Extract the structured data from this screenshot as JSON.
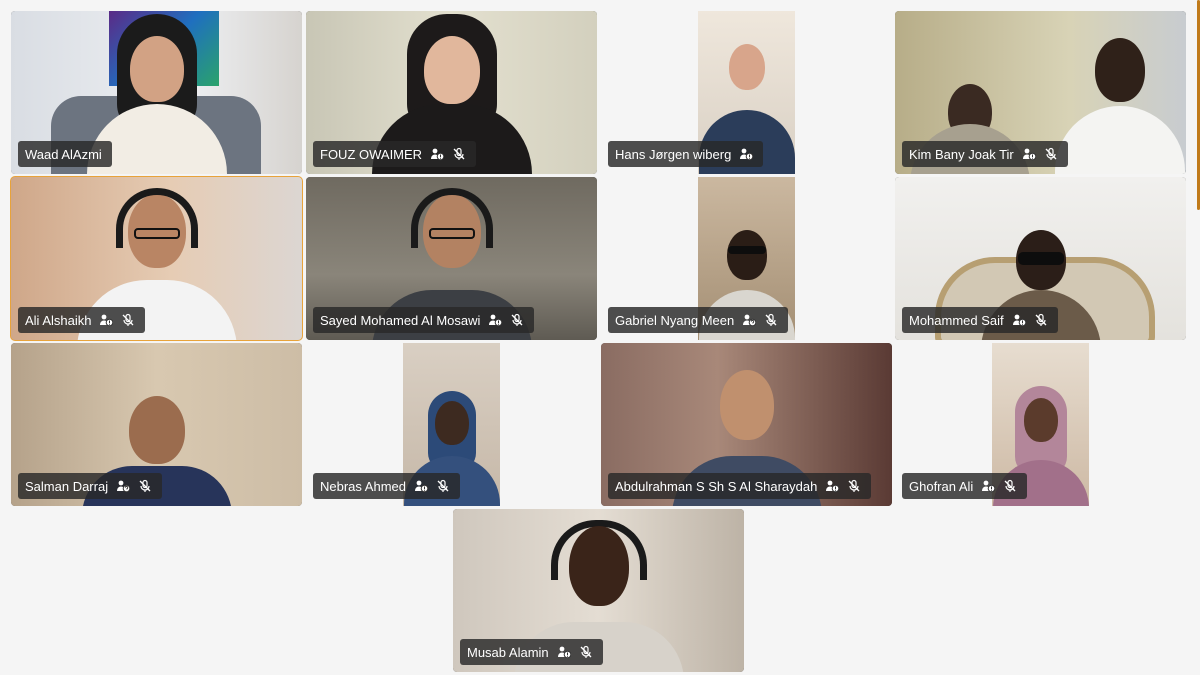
{
  "meeting": {
    "participants": [
      {
        "name": "Waad AlAzmi",
        "icons": []
      },
      {
        "name": "FOUZ OWAIMER",
        "icons": [
          "people-icon",
          "mic-off-icon"
        ]
      },
      {
        "name": "Hans Jørgen wiberg",
        "icons": [
          "people-icon"
        ]
      },
      {
        "name": "Kim Bany Joak Tir",
        "icons": [
          "people-icon",
          "mic-off-icon"
        ]
      },
      {
        "name": "Ali Alshaikh",
        "icons": [
          "people-icon",
          "mic-off-icon"
        ],
        "active": true
      },
      {
        "name": "Sayed Mohamed Al Mosawi",
        "icons": [
          "people-icon",
          "mic-off-icon"
        ]
      },
      {
        "name": "Gabriel Nyang Meen",
        "icons": [
          "people-question-icon",
          "mic-off-icon"
        ]
      },
      {
        "name": "Mohammed Saif",
        "icons": [
          "people-icon",
          "mic-off-icon"
        ]
      },
      {
        "name": "Salman Darraj",
        "icons": [
          "people-question-icon",
          "mic-off-icon"
        ]
      },
      {
        "name": "Nebras Ahmed",
        "icons": [
          "people-icon",
          "mic-off-icon"
        ]
      },
      {
        "name": "Abdulrahman S Sh S Al Sharaydah",
        "icons": [
          "people-icon",
          "mic-off-icon"
        ]
      },
      {
        "name": "Ghofran Ali",
        "icons": [
          "people-icon",
          "mic-off-icon"
        ]
      },
      {
        "name": "Musab Alamin",
        "icons": [
          "people-icon",
          "mic-off-icon"
        ]
      }
    ]
  },
  "colors": {
    "background": "#f5f5f5",
    "active_speaker_border": "#e8a33a",
    "name_tag_bg": "#282828"
  }
}
